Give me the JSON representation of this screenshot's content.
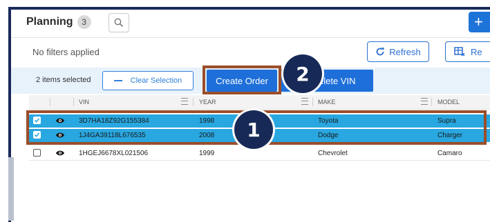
{
  "header": {
    "title": "Planning",
    "count": "3",
    "add_label": "+"
  },
  "filters": {
    "status": "No filters applied",
    "refresh_label": "Refresh",
    "reset_label": "Re"
  },
  "selection_bar": {
    "selected_text": "2 items selected",
    "clear_label": "Clear Selection",
    "create_order_label": "Create Order",
    "delete_vin_label": "elete VIN"
  },
  "grid": {
    "columns": [
      "VIN",
      "YEAR",
      "MAKE",
      "MODEL"
    ],
    "rows": [
      {
        "selected": true,
        "vin": "3D7HA18Z92G155384",
        "year": "1998",
        "make": "Toyota",
        "model": "Supra"
      },
      {
        "selected": true,
        "vin": "1J4GA39118L676535",
        "year": "2008",
        "make": "Dodge",
        "model": "Charger"
      },
      {
        "selected": false,
        "vin": "1HGEJ6678XL021506",
        "year": "1999",
        "make": "Chevrolet",
        "model": "Camaro"
      }
    ]
  },
  "annotations": {
    "badge_1": "1",
    "badge_2": "2",
    "color": "#9a4e2a",
    "badge_color": "#172a57"
  },
  "colors": {
    "accent": "#1e6fd9",
    "row_selected": "#29a7e0",
    "selection_bar": "#e8f2fb"
  }
}
